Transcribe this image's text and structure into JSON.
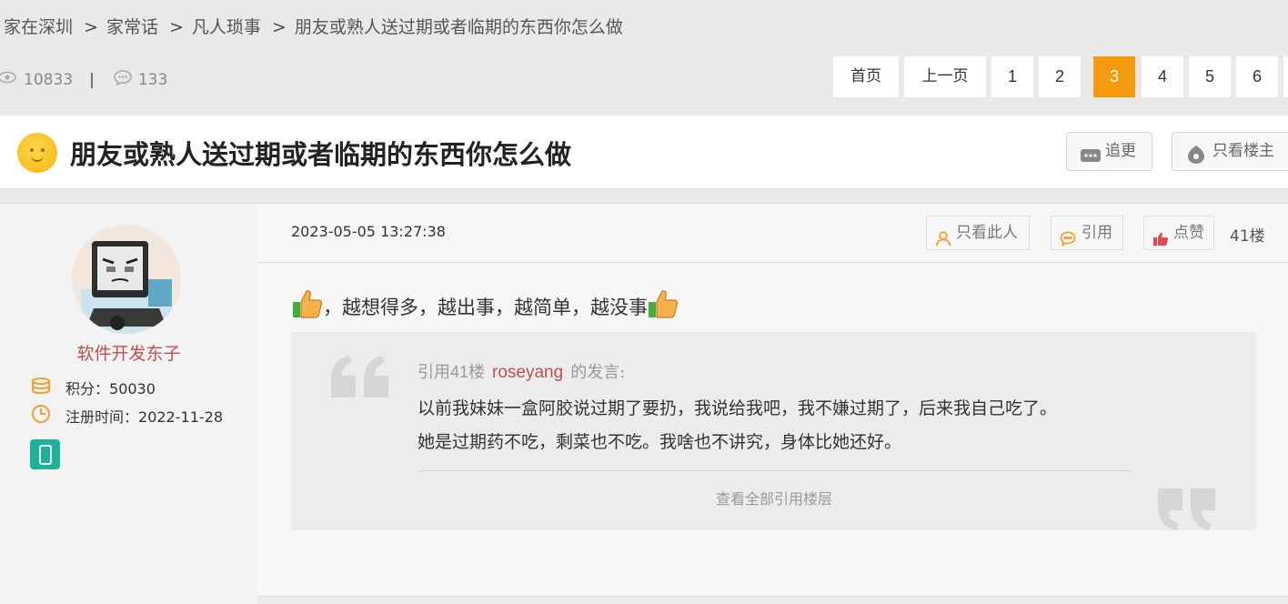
{
  "breadcrumb": {
    "items": [
      "家在深圳",
      "家常话",
      "凡人琐事",
      "朋友或熟人送过期或者临期的东西你怎么做"
    ],
    "separator": ">"
  },
  "stats": {
    "views": "10833",
    "divider": "|",
    "replies": "133"
  },
  "pagination": {
    "first": "首页",
    "prev": "上一页",
    "pages": [
      "1",
      "2",
      "3",
      "4",
      "5",
      "6"
    ],
    "current": "3"
  },
  "topic": {
    "title": "朋友或熟人送过期或者临期的东西你怎么做",
    "follow_label": "追更",
    "owner_only_label": "只看楼主"
  },
  "author": {
    "name": "软件开发东子",
    "points_label": "积分：",
    "points": "50030",
    "reg_label": "注册时间：",
    "reg_date": "2022-11-28"
  },
  "post": {
    "time": "2023-05-05 13:27:38",
    "only_this_label": "只看此人",
    "quote_label": "引用",
    "like_label": "点赞",
    "floor": "41楼",
    "content_text": "，越想得多，越出事，越简单，越没事"
  },
  "quote": {
    "prefix": "引用",
    "floor_no": "41",
    "floor_unit": "楼",
    "user": "roseyang",
    "suffix": "的发言:",
    "line1": "以前我妹妹一盒阿胶说过期了要扔，我说给我吧，我不嫌过期了，后来我自己吃了。",
    "line2": "她是过期药不吃，剩菜也不吃。我啥也不讲究，身体比她还好。",
    "view_all": "查看全部引用楼层"
  },
  "colors": {
    "accent": "#f59a0c",
    "username": "#c0504d",
    "device_badge": "#1bb39a"
  },
  "icons": [
    "eye-icon",
    "comment-icon",
    "smiley-icon",
    "chat-icon",
    "owner-icon",
    "person-icon",
    "quote-icon",
    "like-icon",
    "coins-icon",
    "clock-icon",
    "phone-icon",
    "thumbs-up-icon",
    "quote-open-icon",
    "quote-close-icon"
  ]
}
